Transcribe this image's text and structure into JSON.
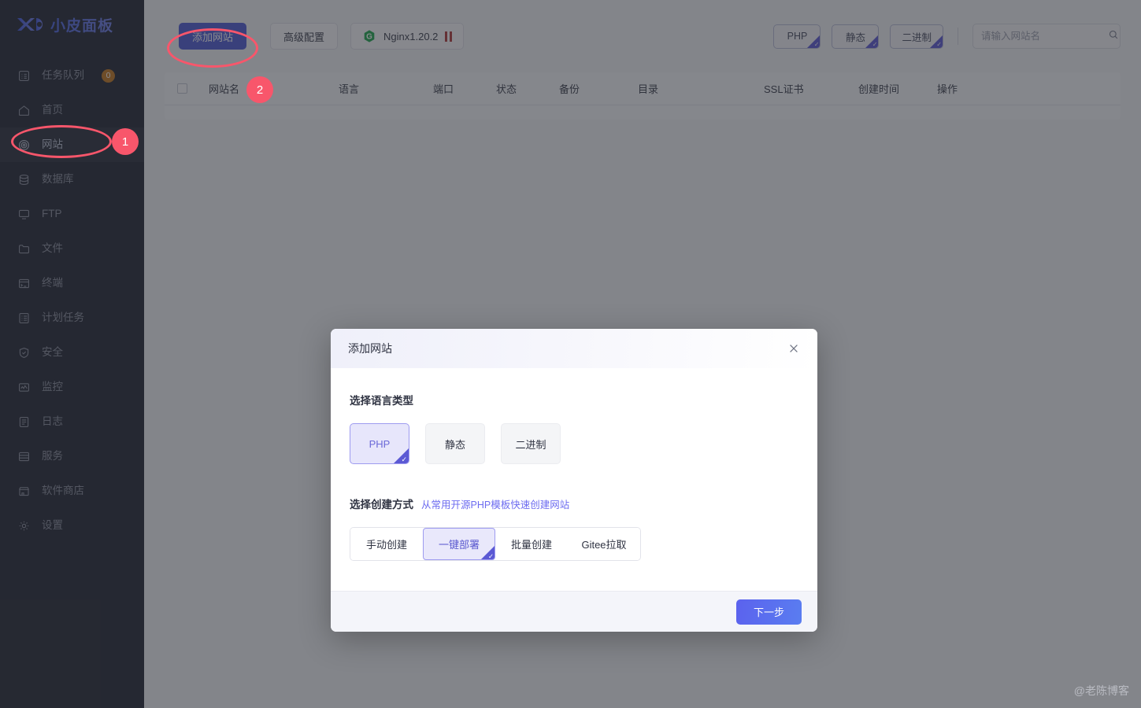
{
  "sidebar": {
    "logo_text": "小皮面板",
    "items": [
      {
        "label": "任务队列",
        "icon": "task-queue-icon",
        "badge": "0",
        "active": false
      },
      {
        "label": "首页",
        "icon": "home-icon",
        "active": false
      },
      {
        "label": "网站",
        "icon": "website-icon",
        "active": true
      },
      {
        "label": "数据库",
        "icon": "database-icon",
        "active": false
      },
      {
        "label": "FTP",
        "icon": "ftp-icon",
        "active": false
      },
      {
        "label": "文件",
        "icon": "file-icon",
        "active": false
      },
      {
        "label": "终端",
        "icon": "terminal-icon",
        "active": false
      },
      {
        "label": "计划任务",
        "icon": "cron-icon",
        "active": false
      },
      {
        "label": "安全",
        "icon": "shield-icon",
        "active": false
      },
      {
        "label": "监控",
        "icon": "monitor-icon",
        "active": false
      },
      {
        "label": "日志",
        "icon": "log-icon",
        "active": false
      },
      {
        "label": "服务",
        "icon": "service-icon",
        "active": false
      },
      {
        "label": "软件商店",
        "icon": "store-icon",
        "active": false
      },
      {
        "label": "设置",
        "icon": "gear-icon",
        "active": false
      }
    ]
  },
  "toolbar": {
    "add_site_label": "添加网站",
    "advanced_config_label": "高级配置",
    "nginx_label": "Nginx1.20.2",
    "nginx_status_icon": "pause-icon",
    "tags": [
      {
        "label": "PHP"
      },
      {
        "label": "静态"
      },
      {
        "label": "二进制"
      }
    ],
    "search_placeholder": "请输入网站名",
    "search_value": ""
  },
  "table": {
    "columns": [
      "网站名",
      "语言",
      "端口",
      "状态",
      "备份",
      "目录",
      "SSL证书",
      "创建时间",
      "操作"
    ],
    "rows": []
  },
  "modal": {
    "title": "添加网站",
    "close_icon": "close-icon",
    "lang_section": {
      "label": "选择语言类型",
      "options": [
        {
          "label": "PHP",
          "selected": true
        },
        {
          "label": "静态",
          "selected": false
        },
        {
          "label": "二进制",
          "selected": false
        }
      ]
    },
    "create_section": {
      "label": "选择创建方式",
      "hint": "从常用开源PHP模板快速创建网站",
      "options": [
        {
          "label": "手动创建",
          "selected": false
        },
        {
          "label": "一键部署",
          "selected": true
        },
        {
          "label": "批量创建",
          "selected": false
        },
        {
          "label": "Gitee拉取",
          "selected": false
        }
      ]
    },
    "next_label": "下一步"
  },
  "annotations": [
    {
      "number": "1"
    },
    {
      "number": "2"
    }
  ],
  "watermark": "@老陈博客",
  "colors": {
    "accent": "#4f5bd5",
    "purple": "#5b59d4",
    "annotation": "#f8566b",
    "sidebar_bg": "#232733",
    "badge_orange": "#c4791f",
    "green": "#1fa84f",
    "pause_red": "#b03a3a"
  }
}
